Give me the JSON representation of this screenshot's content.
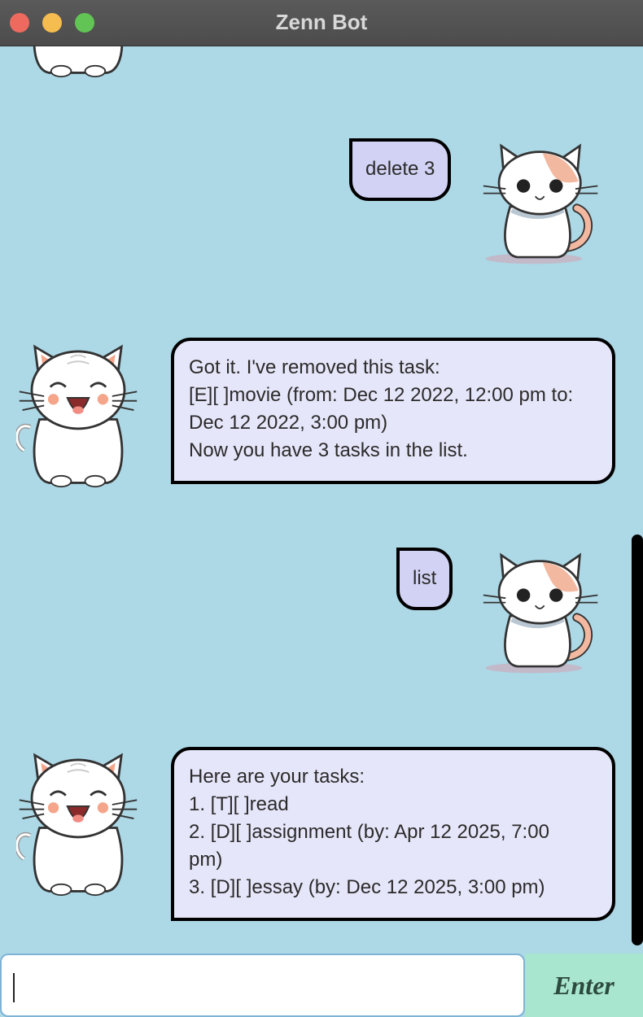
{
  "window": {
    "title": "Zenn Bot"
  },
  "messages": [
    {
      "sender": "user",
      "text": "delete 3"
    },
    {
      "sender": "bot",
      "lines": [
        "Got it. I've removed this task:",
        "[E][ ]movie (from: Dec 12 2022, 12:00 pm to:",
        "Dec 12 2022, 3:00 pm)",
        "Now you have 3 tasks in the list."
      ]
    },
    {
      "sender": "user",
      "text": "list"
    },
    {
      "sender": "bot",
      "lines": [
        "Here are your tasks:",
        "1. [T][ ]read",
        "2. [D][ ]assignment (by: Apr 12 2025, 7:00",
        "pm)",
        "3. [D][ ]essay (by: Dec 12 2025, 3:00 pm)"
      ]
    }
  ],
  "input": {
    "value": "",
    "placeholder": ""
  },
  "enter_button": {
    "label": "Enter"
  },
  "icons": {
    "user_avatar": "calico-cat-icon",
    "bot_avatar": "white-cat-laughing-icon"
  },
  "colors": {
    "background": "#add8e6",
    "user_bubble": "#d2d2f5",
    "bot_bubble": "#e6e6fa",
    "enter_button": "#a8e6cf"
  }
}
